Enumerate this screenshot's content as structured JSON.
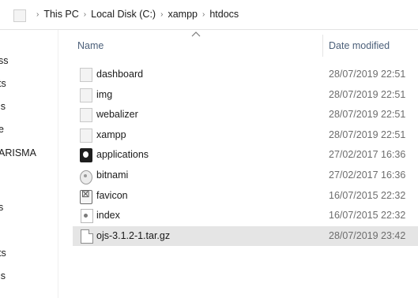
{
  "address": {
    "folder_icon": "folder-icon",
    "crumbs": [
      "This PC",
      "Local Disk (C:)",
      "xampp",
      "htdocs"
    ],
    "separator": "›"
  },
  "nav": {
    "items": [
      "ss",
      "ts",
      "ls",
      "e",
      "ARISMA",
      "s",
      "ts",
      "ls"
    ]
  },
  "columns": {
    "name": "Name",
    "date_modified": "Date modified",
    "sort_indicator": "^"
  },
  "files": [
    {
      "name": "dashboard",
      "date": "28/07/2019 22:51",
      "icon": "folder-icon"
    },
    {
      "name": "img",
      "date": "28/07/2019 22:51",
      "icon": "folder-icon"
    },
    {
      "name": "webalizer",
      "date": "28/07/2019 22:51",
      "icon": "folder-icon"
    },
    {
      "name": "xampp",
      "date": "28/07/2019 22:51",
      "icon": "folder-icon"
    },
    {
      "name": "applications",
      "date": "27/02/2017 16:36",
      "icon": "application-icon"
    },
    {
      "name": "bitnami",
      "date": "27/02/2017 16:36",
      "icon": "settings-file-icon"
    },
    {
      "name": "favicon",
      "date": "16/07/2015 22:32",
      "icon": "favicon-icon"
    },
    {
      "name": "index",
      "date": "16/07/2015 22:32",
      "icon": "html-file-icon"
    },
    {
      "name": "ojs-3.1.2-1.tar.gz",
      "date": "28/07/2019 23:42",
      "icon": "archive-file-icon"
    }
  ],
  "selected_file": "ojs-3.1.2-1.tar.gz",
  "colors": {
    "header_text": "#4c607a",
    "date_text": "#6d6d6d",
    "selection_bg": "#e5e5e5"
  }
}
